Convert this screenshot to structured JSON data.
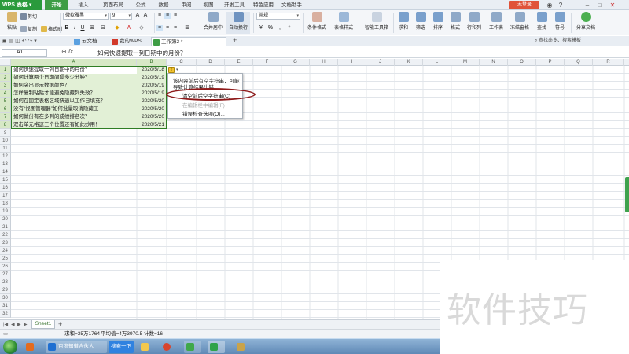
{
  "app": {
    "logo": "WPS 表格",
    "login_button": "未登录"
  },
  "menu_tabs": [
    "开始",
    "插入",
    "页面布局",
    "公式",
    "数据",
    "审阅",
    "视图",
    "开发工具",
    "特色应用",
    "文档助手"
  ],
  "ribbon": {
    "paste": "粘贴",
    "cut": "剪切",
    "copy": "复制",
    "format_painter": "格式刷",
    "font_name": "微软雅黑",
    "font_size": "9",
    "merge_center": "合并居中",
    "wrap_text": "自动换行",
    "number_format": "常规",
    "percent": "%",
    "conditional_format": "条件格式",
    "table_style": "表格样式",
    "smart_toolbox": "智能工具箱",
    "sum": "求和",
    "filter": "筛选",
    "sort": "排序",
    "format": "格式",
    "row_col": "行和列",
    "worksheet": "工作表",
    "freeze": "冻结窗格",
    "find": "查找",
    "symbol": "符号",
    "share": "分享文档"
  },
  "doc_tabs": {
    "cloud": "云文档",
    "my_wps": "我的WPS",
    "workbook": "工作簿2 *"
  },
  "search_command": "查找命令、搜索模板",
  "formula_bar": {
    "cell_ref": "A1",
    "fx": "fx",
    "content": "如何快速提取一列日期中的月份？"
  },
  "columns": [
    "A",
    "B",
    "C",
    "D",
    "E",
    "F",
    "G",
    "H",
    "I",
    "J",
    "K",
    "L",
    "M",
    "N",
    "O",
    "P",
    "Q",
    "R"
  ],
  "rows": [
    "1",
    "2",
    "3",
    "4",
    "5",
    "6",
    "7",
    "8",
    "9",
    "10",
    "11",
    "12",
    "13",
    "14",
    "15",
    "16",
    "17",
    "18",
    "19",
    "20",
    "21",
    "22",
    "23",
    "24",
    "25",
    "26",
    "27",
    "28",
    "29",
    "30",
    "31",
    "32"
  ],
  "cells": [
    {
      "a": "如何快速提取一列日期中的月份？",
      "b": "2020/5/18"
    },
    {
      "a": "如何计算两个日期间隔多少分钟？",
      "b": "2020/5/19"
    },
    {
      "a": "如何突出显示数据颜色？",
      "b": "2020/5/19"
    },
    {
      "a": "怎样复制粘贴才能避免隐藏列失效？",
      "b": "2020/5/19"
    },
    {
      "a": "如何在固定表格区域快速以工作日填充？",
      "b": "2020/5/20"
    },
    {
      "a": "没有“视图管理器”如何批量取消隐藏工",
      "b": "2020/5/20"
    },
    {
      "a": "如何做份有在多列的成绩排名次？",
      "b": "2020/5/20"
    },
    {
      "a": "双击单元格这三个位置还有如此妙用！",
      "b": "2020/5/21"
    }
  ],
  "error_menu": {
    "message_line1": "该内容前后有空字符串，可能",
    "message_line2": "导致计算结果出错！",
    "item_clear": "清空前后空字符串(C)",
    "item_ignore": "在编辑栏中编辑(F)",
    "item_options": "错误检查选项(O)..."
  },
  "sheet": {
    "tab": "Sheet1"
  },
  "status": {
    "sum": "求和=35万1764",
    "average": "平均值=4万3970.5",
    "count": "计数=16"
  },
  "taskbar": {
    "ime": "百度知道合伙人",
    "search": "搜索一下"
  },
  "watermark": "软件技巧",
  "colors": {
    "brand_green": "#3e9d45",
    "selection_fill": "#e2f0d6",
    "selection_border": "#2f7d25",
    "login_red": "#e0533a",
    "highlight_ring": "#8e1a1a"
  }
}
